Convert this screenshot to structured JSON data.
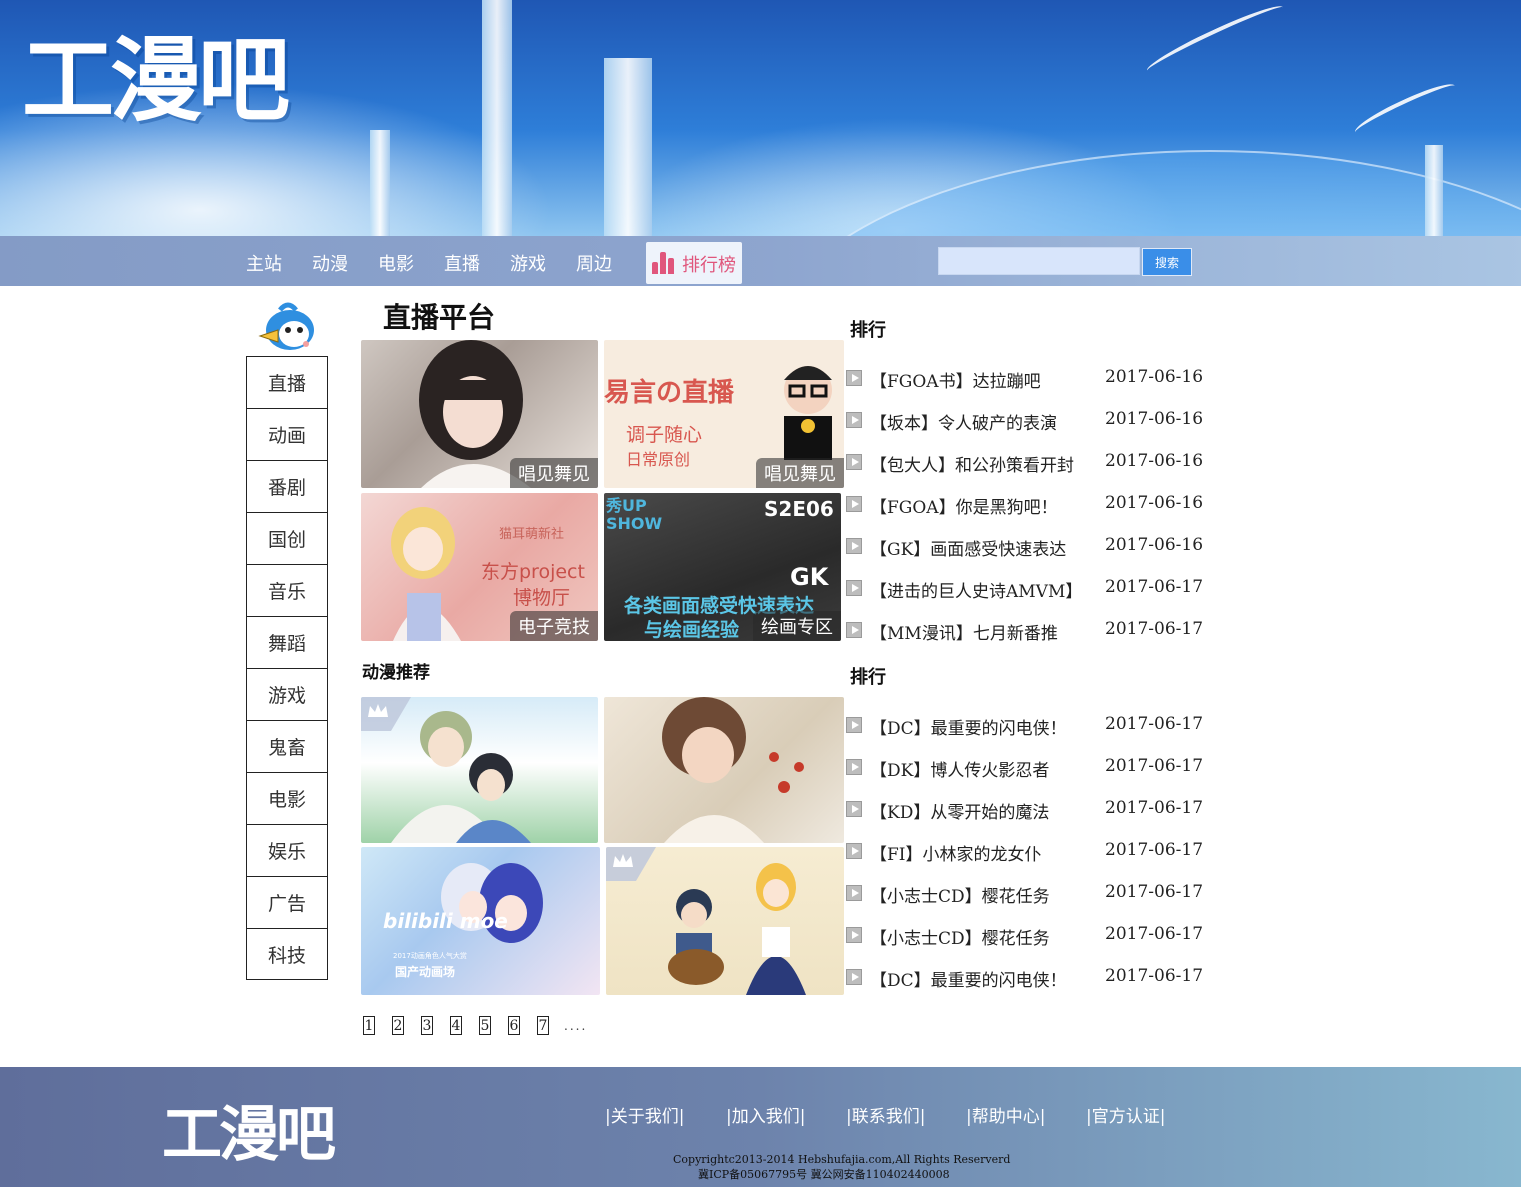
{
  "brand": {
    "logo_text": "工漫吧",
    "footer_logo_text": "工漫吧"
  },
  "nav": {
    "items": [
      "主站",
      "动漫",
      "电影",
      "直播",
      "游戏",
      "周边"
    ],
    "rank_label": "排行榜",
    "rank_color": "#e0567c",
    "search_placeholder": "",
    "search_button": "搜索"
  },
  "sidebar": {
    "items": [
      "直播",
      "动画",
      "番剧",
      "国创",
      "音乐",
      "舞蹈",
      "游戏",
      "鬼畜",
      "电影",
      "娱乐",
      "广告",
      "科技"
    ]
  },
  "live": {
    "title": "直播平台",
    "tiles": [
      {
        "caption": "唱见舞见"
      },
      {
        "caption": "唱见舞见",
        "text_main": "易言の直播",
        "text_sub1": "调子随心",
        "text_sub2": "日常原创"
      },
      {
        "caption": "电子竞技",
        "text_main": "东方project",
        "text_sub": "博物厅",
        "text_top": "猫耳萌新社"
      },
      {
        "caption": "绘画专区",
        "text_top": "S2E06",
        "text_gk": "GK",
        "text_l1": "各类画面感受快速表达",
        "text_l2": "与绘画经验",
        "text_show": "秀UP SHOW"
      }
    ]
  },
  "anime": {
    "title": "动漫推荐",
    "tiles": [
      {
        "name": "anime-1"
      },
      {
        "name": "anime-2"
      },
      {
        "name": "anime-3",
        "text_main": "bilibili moe",
        "text_sub": "国产动画场",
        "text_tiny": "2017动画角色人气大赏"
      },
      {
        "name": "anime-4"
      }
    ]
  },
  "pager": {
    "pages": [
      "1",
      "2",
      "3",
      "4",
      "5",
      "6",
      "7"
    ],
    "ellipsis": "...."
  },
  "ranking1": {
    "title": "排行",
    "rows": [
      {
        "title": "【FGOA书】达拉蹦吧",
        "date": "2017-06-16"
      },
      {
        "title": "【坂本】令人破产的表演",
        "date": "2017-06-16"
      },
      {
        "title": "【包大人】和公孙策看开封",
        "date": "2017-06-16"
      },
      {
        "title": "【FGOA】你是黑狗吧！",
        "date": "2017-06-16"
      },
      {
        "title": "【GK】画面感受快速表达",
        "date": "2017-06-16"
      },
      {
        "title": "【进击的巨人史诗AMVM】",
        "date": "2017-06-17"
      },
      {
        "title": "【MM漫讯】七月新番推",
        "date": "2017-06-17"
      }
    ]
  },
  "ranking2": {
    "title": "排行",
    "rows": [
      {
        "title": "【DC】最重要的闪电侠！",
        "date": "2017-06-17"
      },
      {
        "title": "【DK】博人传火影忍者",
        "date": "2017-06-17"
      },
      {
        "title": "【KD】从零开始的魔法",
        "date": "2017-06-17"
      },
      {
        "title": "【FI】小林家的龙女仆",
        "date": "2017-06-17"
      },
      {
        "title": "【小志士CD】樱花任务",
        "date": "2017-06-17"
      },
      {
        "title": "【小志士CD】樱花任务",
        "date": "2017-06-17"
      },
      {
        "title": "【DC】最重要的闪电侠！",
        "date": "2017-06-17"
      }
    ]
  },
  "footer": {
    "links": [
      "|关于我们|",
      "|加入我们|",
      "|联系我们|",
      "|帮助中心|",
      "|官方认证|"
    ],
    "copyright": "Copyrightc2013-2014  Hebshufajia.com,All Rights Reserverd",
    "icp": "冀ICP备05067795号    冀公网安备110402440008"
  }
}
